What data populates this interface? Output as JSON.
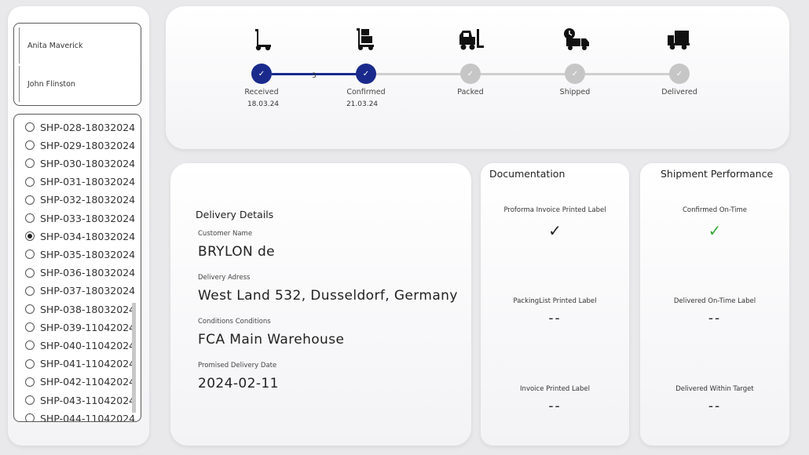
{
  "people": [
    "Anita Maverick",
    "John Flinston"
  ],
  "shipments": {
    "items": [
      "SHP-028-18032024",
      "SHP-029-18032024",
      "SHP-030-18032024",
      "SHP-031-18032024",
      "SHP-032-18032024",
      "SHP-033-18032024",
      "SHP-034-18032024",
      "SHP-035-18032024",
      "SHP-036-18032024",
      "SHP-037-18032024",
      "SHP-038-18032024",
      "SHP-039-11042024",
      "SHP-040-11042024",
      "SHP-041-11042024",
      "SHP-042-11042024",
      "SHP-043-11042024",
      "SHP-044-11042024"
    ],
    "selected": "SHP-034-18032024"
  },
  "progress": {
    "steps": [
      {
        "label": "Received",
        "date": "18.03.24",
        "status": "done",
        "icon": "hand-truck-icon"
      },
      {
        "label": "Confirmed",
        "date": "21.03.24",
        "status": "done",
        "icon": "hand-truck-boxes-icon"
      },
      {
        "label": "Packed",
        "date": "",
        "status": "pending",
        "icon": "forklift-icon"
      },
      {
        "label": "Shipped",
        "date": "",
        "status": "pending",
        "icon": "truck-clock-icon"
      },
      {
        "label": "Delivered",
        "date": "",
        "status": "pending",
        "icon": "delivery-truck-icon"
      }
    ],
    "gap_days": "3",
    "check_glyph": "✓",
    "colors": {
      "done": "#1a2a8c",
      "pending": "#c6c6c6"
    }
  },
  "delivery": {
    "heading": "Delivery Details",
    "customer_label": "Customer Name",
    "customer_value": "BRYLON de",
    "address_label": "Delivery Adress",
    "address_value": "West Land 532, Dusseldorf, Germany",
    "conditions_label": "Conditions Conditions",
    "conditions_value": "FCA Main Warehouse",
    "date_label": "Promised Delivery Date",
    "date_value": "2024-02-11"
  },
  "documentation": {
    "title": "Documentation",
    "items": [
      {
        "label": "Proforma Invoice Printed Label",
        "value": "✓"
      },
      {
        "label": "PackingList Printed Label",
        "value": "--"
      },
      {
        "label": "Invoice Printed Label",
        "value": "--"
      }
    ]
  },
  "performance": {
    "title": "Shipment Performance",
    "items": [
      {
        "label": "Confirmed On-Time",
        "value": "✓"
      },
      {
        "label": "Delivered On-Time Label",
        "value": "--"
      },
      {
        "label": "Delivered Within Target",
        "value": "--"
      }
    ]
  }
}
